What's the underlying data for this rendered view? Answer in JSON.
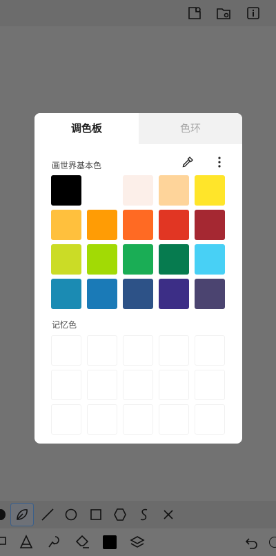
{
  "dialog": {
    "tabs": [
      {
        "label": "调色板",
        "active": true
      },
      {
        "label": "色环",
        "active": false
      }
    ],
    "basic_colors_label": "画世界基本色",
    "memory_colors_label": "记忆色",
    "basic_colors": [
      "#000000",
      "#ffffff",
      "#fcefe9",
      "#fed49a",
      "#ffe52a",
      "#ffc03d",
      "#ff9c05",
      "#ff6a23",
      "#e13623",
      "#a52832",
      "#cbdc26",
      "#a2da05",
      "#1aad55",
      "#067b4f",
      "#48d0f5",
      "#1b8bb3",
      "#1a7ab7",
      "#2d5287",
      "#3c2e86",
      "#4b4470"
    ],
    "memory_colors_count": 15
  },
  "icons": {
    "top": [
      "layer-info-icon",
      "gallery-icon",
      "info-icon"
    ],
    "shape_bar": [
      "lasso-icon",
      "freeform-icon",
      "line-icon",
      "circle-icon",
      "square-icon",
      "hexagon-icon",
      "curve-icon",
      "close-icon"
    ],
    "tool_bar": [
      "select-icon",
      "fill-icon",
      "brush-icon",
      "eraser-icon",
      "color-icon",
      "layers-icon",
      "undo-icon"
    ]
  }
}
